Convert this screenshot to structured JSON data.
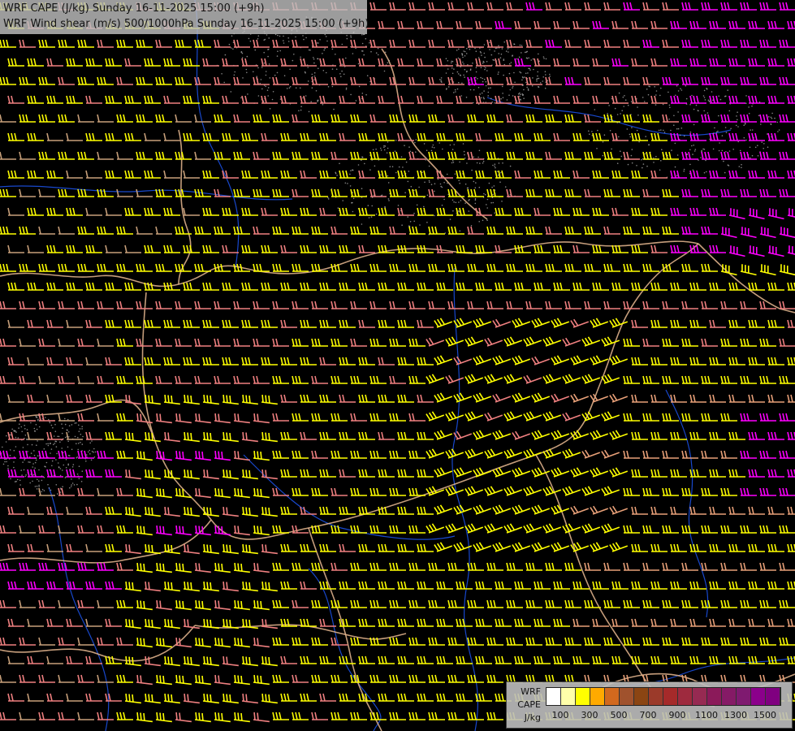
{
  "title": {
    "line1": "WRF CAPE (J/kg) Sunday 16-11-2025 15:00 (+9h)",
    "line2": "WRF Wind shear (m/s) 500/1000hPa Sunday 16-11-2025 15:00 (+9h)"
  },
  "legend": {
    "label_model": "WRF",
    "label_var": "CAPE",
    "label_unit": "J/kg",
    "colors": [
      "#ffffff",
      "#ffffaa",
      "#ffff00",
      "#ffaa00",
      "#d2691e",
      "#a0522d",
      "#8b4513",
      "#9b3a2a",
      "#a52a2a",
      "#9e2a3e",
      "#962a52",
      "#8b1a5a",
      "#851a66",
      "#7f1a70",
      "#8b008b",
      "#800080"
    ],
    "tick_labels": [
      "100",
      "300",
      "500",
      "700",
      "900",
      "1100",
      "1300",
      "1500"
    ]
  },
  "map": {
    "background": "#000000",
    "shear_colors": {
      "weak": "#c8a07a",
      "light": "#e8a078",
      "moderate": "#f08080",
      "strong": "#ffff00",
      "very_strong": "#ff00ff"
    },
    "border_color": "#e8b890",
    "river_color": "#1e5aff"
  }
}
